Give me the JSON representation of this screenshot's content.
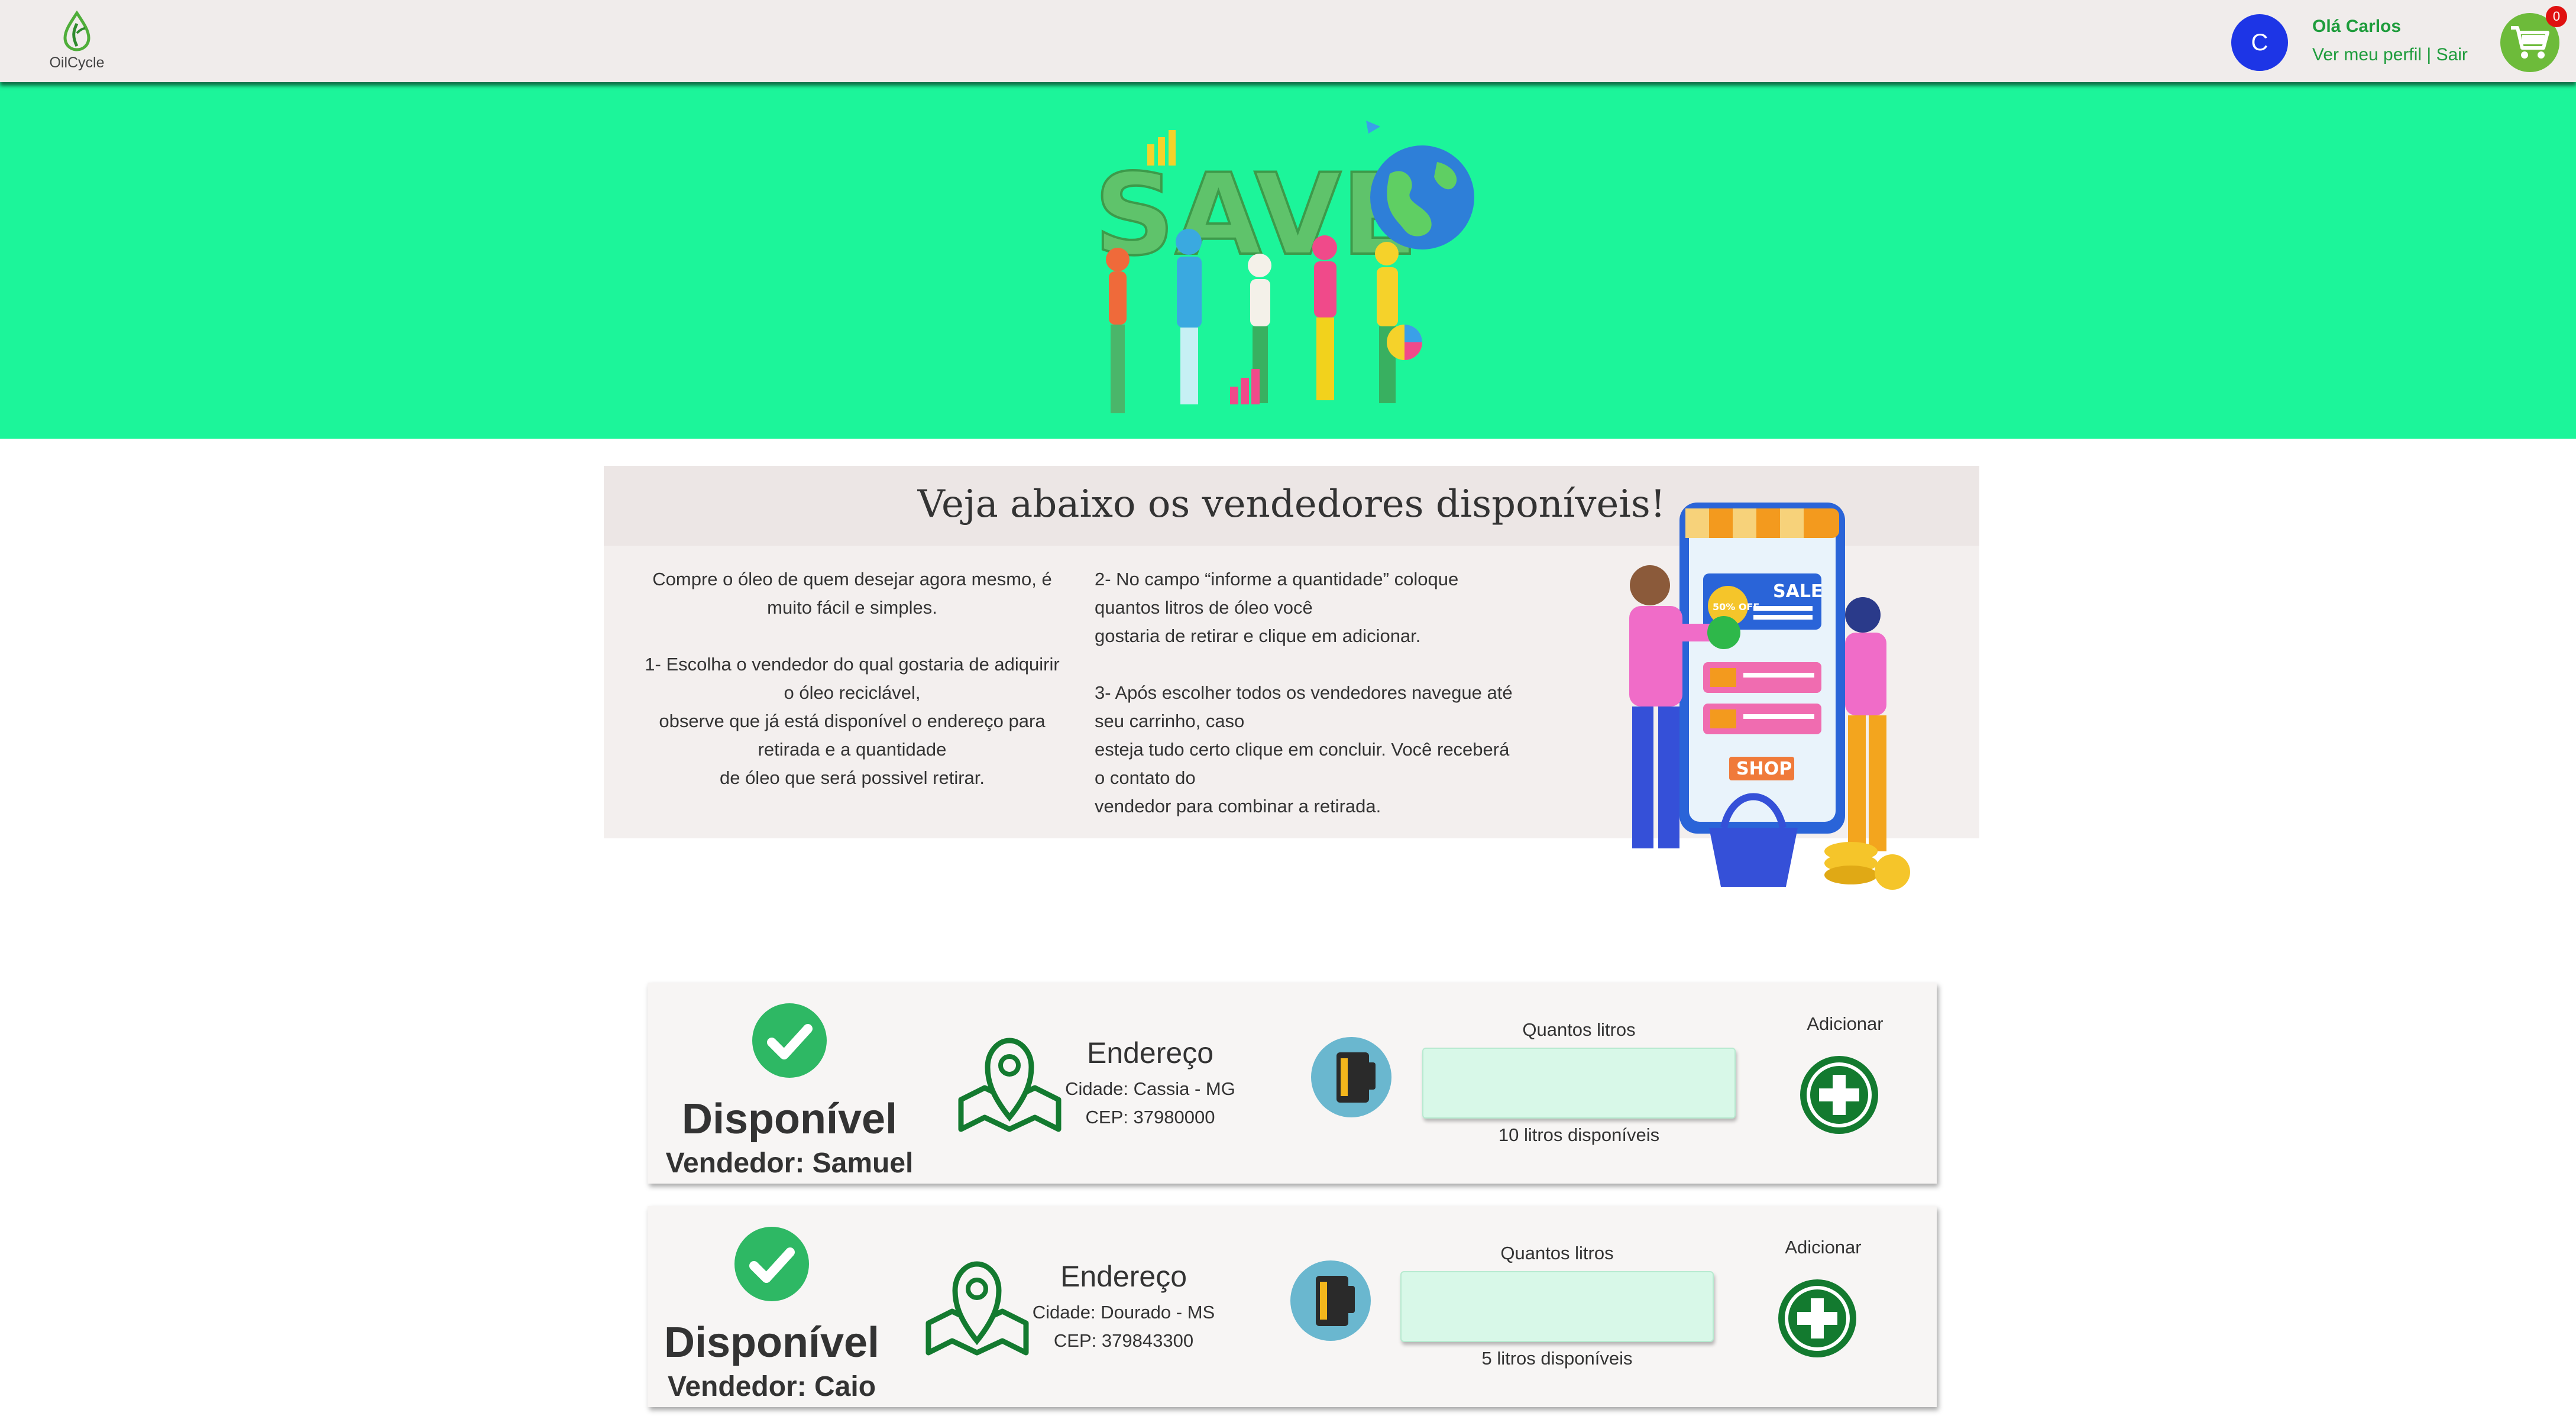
{
  "header": {
    "logo_text": "OilCycle",
    "avatar_initial": "C",
    "greeting": "Olá Carlos",
    "profile_link": "Ver meu perfil",
    "separator": " | ",
    "logout_link": "Sair",
    "cart_count": "0"
  },
  "hero": {
    "art_text": "SAVE"
  },
  "info": {
    "title": "Veja abaixo os vendedores disponíveis!",
    "col1": [
      "Compre o óleo de quem desejar agora mesmo, é",
      "muito fácil e simples.",
      "",
      "1- Escolha o vendedor do qual gostaria de adiquirir",
      "o óleo reciclável,",
      "observe que já está disponível o endereço para",
      "retirada e a quantidade",
      "de óleo que será possivel retirar."
    ],
    "col2": [
      "2- No campo “informe a quantidade” coloque",
      "quantos litros de óleo você",
      "gostaria de retirar e clique em adicionar.",
      "",
      "3- Após escolher todos os vendedores navegue até",
      "seu carrinho, caso",
      "esteja tudo certo clique em concluir. Você receberá",
      "o contato do",
      "vendedor para combinar a retirada."
    ],
    "shop_art": {
      "sale": "SALE",
      "discount": "50% OFF",
      "shop": "SHOP"
    }
  },
  "sellers": [
    {
      "status": "Disponível",
      "vendor": "Vendedor: Samuel",
      "address_title": "Endereço",
      "city": "Cidade: Cassia - MG",
      "cep": "CEP: 37980000",
      "qty_label": "Quantos litros",
      "qty_value": "",
      "available": "10 litros disponíveis",
      "add_label": "Adicionar"
    },
    {
      "status": "Disponível",
      "vendor": "Vendedor: Caio",
      "address_title": "Endereço",
      "city": "Cidade: Dourado - MS",
      "cep": "CEP: 379843300",
      "qty_label": "Quantos litros",
      "qty_value": "",
      "available": "5 litros disponíveis",
      "add_label": "Adicionar"
    }
  ],
  "colors": {
    "header_bg": "#f0eceb",
    "hero_bg": "#1cf59a",
    "accent_green": "#1e9c3c",
    "avatar_blue": "#1d35e6",
    "cart_green": "#6dbb3a",
    "badge_red": "#e01010",
    "add_button_green": "#137a2f"
  },
  "icons": {
    "logo": "leaf-drop-icon",
    "cart": "shopping-cart-icon",
    "available": "check-circle-icon",
    "location": "map-pin-icon",
    "oil": "oil-container-icon",
    "add": "plus-circle-icon"
  }
}
